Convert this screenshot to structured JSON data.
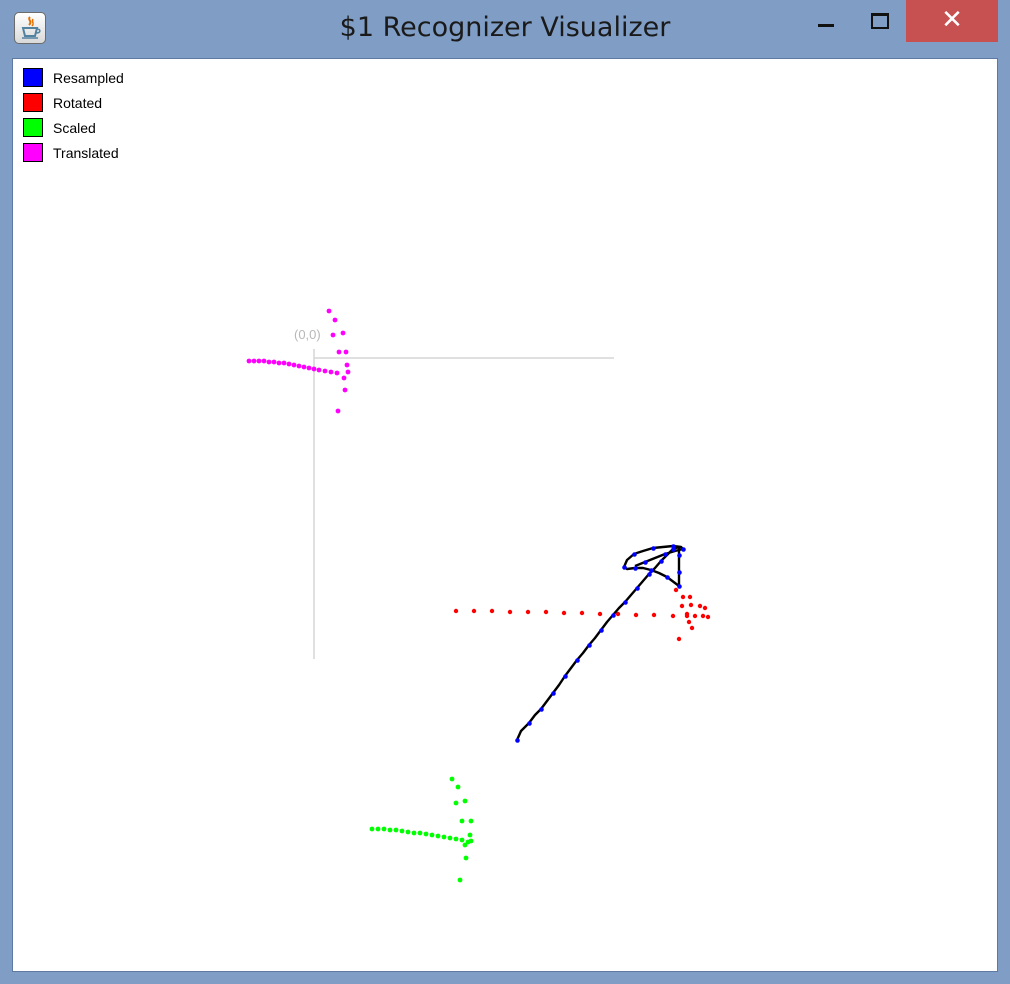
{
  "window": {
    "title": "$1 Recognizer Visualizer",
    "icon": "java-icon",
    "controls": [
      "minimize-icon",
      "maximize-icon",
      "close-icon"
    ],
    "close_glyph": "✕"
  },
  "legend": [
    {
      "label": "Resampled",
      "color": "#0000ff"
    },
    {
      "label": "Rotated",
      "color": "#ff0000"
    },
    {
      "label": "Scaled",
      "color": "#00ff00"
    },
    {
      "label": "Translated",
      "color": "#ff00ff"
    }
  ],
  "axes": {
    "origin_label": "(0,0)",
    "axis_color": "#d0d0d0"
  },
  "stroke": {
    "raw_color": "#000000"
  }
}
